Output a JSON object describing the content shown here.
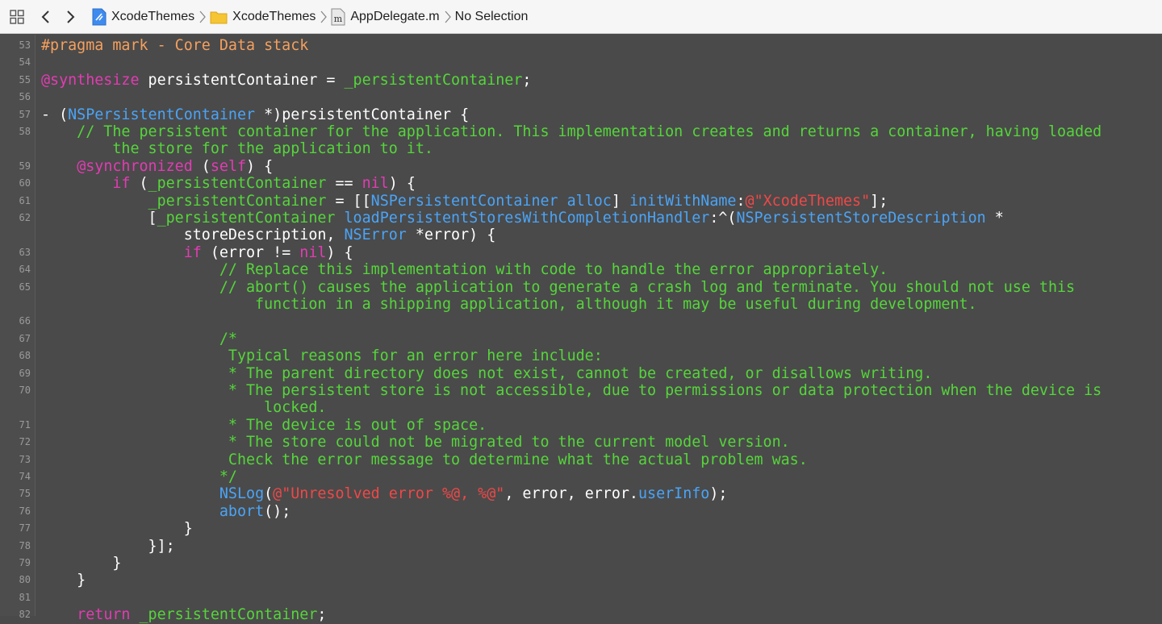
{
  "jumpbar": {
    "crumbs": [
      {
        "label": "XcodeThemes",
        "icon": "xcode-project-icon"
      },
      {
        "label": "XcodeThemes",
        "icon": "folder-icon"
      },
      {
        "label": "AppDelegate.m",
        "icon": "objc-file-icon",
        "icon_glyph": "m"
      },
      {
        "label": "No Selection",
        "icon": ""
      }
    ]
  },
  "colors": {
    "background": "#4a4a4a",
    "plain": "#ffffff",
    "keyword": "#e23cb3",
    "type": "#4aa4f7",
    "comment": "#55d63a",
    "string": "#f04848",
    "pragma": "#f5a05e"
  },
  "editor": {
    "lines": [
      {
        "n": "53",
        "segs": [
          [
            "pragma",
            "#pragma mark - Core Data stack"
          ]
        ]
      },
      {
        "n": "54",
        "segs": []
      },
      {
        "n": "55",
        "segs": [
          [
            "keyword",
            "@synthesize"
          ],
          [
            "plain",
            " persistentContainer = "
          ],
          [
            "comment",
            "_persistentContainer"
          ],
          [
            "plain",
            ";"
          ]
        ]
      },
      {
        "n": "56",
        "segs": []
      },
      {
        "n": "57",
        "segs": [
          [
            "plain",
            "- ("
          ],
          [
            "type",
            "NSPersistentContainer"
          ],
          [
            "plain",
            " *)persistentContainer {"
          ]
        ]
      },
      {
        "n": "58",
        "segs": [
          [
            "comment",
            "    // The persistent container for the application. This implementation creates and returns a container, having loaded"
          ]
        ]
      },
      {
        "n": "",
        "segs": [
          [
            "comment",
            "        the store for the application to it."
          ]
        ]
      },
      {
        "n": "59",
        "segs": [
          [
            "plain",
            "    "
          ],
          [
            "keyword",
            "@synchronized"
          ],
          [
            "plain",
            " ("
          ],
          [
            "keyword",
            "self"
          ],
          [
            "plain",
            ") {"
          ]
        ]
      },
      {
        "n": "60",
        "segs": [
          [
            "plain",
            "        "
          ],
          [
            "keyword",
            "if"
          ],
          [
            "plain",
            " ("
          ],
          [
            "comment",
            "_persistentContainer"
          ],
          [
            "plain",
            " == "
          ],
          [
            "keyword",
            "nil"
          ],
          [
            "plain",
            ") {"
          ]
        ]
      },
      {
        "n": "61",
        "segs": [
          [
            "plain",
            "            "
          ],
          [
            "comment",
            "_persistentContainer"
          ],
          [
            "plain",
            " = [["
          ],
          [
            "type",
            "NSPersistentContainer"
          ],
          [
            "plain",
            " "
          ],
          [
            "type",
            "alloc"
          ],
          [
            "plain",
            "] "
          ],
          [
            "type",
            "initWithName"
          ],
          [
            "plain",
            ":"
          ],
          [
            "string",
            "@\"XcodeThemes\""
          ],
          [
            "plain",
            "];"
          ]
        ]
      },
      {
        "n": "62",
        "segs": [
          [
            "plain",
            "            ["
          ],
          [
            "comment",
            "_persistentContainer"
          ],
          [
            "plain",
            " "
          ],
          [
            "type",
            "loadPersistentStoresWithCompletionHandler"
          ],
          [
            "plain",
            ":^("
          ],
          [
            "type",
            "NSPersistentStoreDescription"
          ],
          [
            "plain",
            " *"
          ]
        ]
      },
      {
        "n": "",
        "segs": [
          [
            "plain",
            "                storeDescription, "
          ],
          [
            "type",
            "NSError"
          ],
          [
            "plain",
            " *error) {"
          ]
        ]
      },
      {
        "n": "63",
        "segs": [
          [
            "plain",
            "                "
          ],
          [
            "keyword",
            "if"
          ],
          [
            "plain",
            " (error != "
          ],
          [
            "keyword",
            "nil"
          ],
          [
            "plain",
            ") {"
          ]
        ]
      },
      {
        "n": "64",
        "segs": [
          [
            "comment",
            "                    // Replace this implementation with code to handle the error appropriately."
          ]
        ]
      },
      {
        "n": "65",
        "segs": [
          [
            "comment",
            "                    // abort() causes the application to generate a crash log and terminate. You should not use this"
          ]
        ]
      },
      {
        "n": "",
        "segs": [
          [
            "comment",
            "                        function in a shipping application, although it may be useful during development."
          ]
        ]
      },
      {
        "n": "66",
        "segs": []
      },
      {
        "n": "67",
        "segs": [
          [
            "comment",
            "                    /*"
          ]
        ]
      },
      {
        "n": "68",
        "segs": [
          [
            "comment",
            "                     Typical reasons for an error here include:"
          ]
        ]
      },
      {
        "n": "69",
        "segs": [
          [
            "comment",
            "                     * The parent directory does not exist, cannot be created, or disallows writing."
          ]
        ]
      },
      {
        "n": "70",
        "segs": [
          [
            "comment",
            "                     * The persistent store is not accessible, due to permissions or data protection when the device is"
          ]
        ]
      },
      {
        "n": "",
        "segs": [
          [
            "comment",
            "                         locked."
          ]
        ]
      },
      {
        "n": "71",
        "segs": [
          [
            "comment",
            "                     * The device is out of space."
          ]
        ]
      },
      {
        "n": "72",
        "segs": [
          [
            "comment",
            "                     * The store could not be migrated to the current model version."
          ]
        ]
      },
      {
        "n": "73",
        "segs": [
          [
            "comment",
            "                     Check the error message to determine what the actual problem was."
          ]
        ]
      },
      {
        "n": "74",
        "segs": [
          [
            "comment",
            "                    */"
          ]
        ]
      },
      {
        "n": "75",
        "segs": [
          [
            "plain",
            "                    "
          ],
          [
            "type",
            "NSLog"
          ],
          [
            "plain",
            "("
          ],
          [
            "string",
            "@\"Unresolved error %@, %@\""
          ],
          [
            "plain",
            ", error, error."
          ],
          [
            "type",
            "userInfo"
          ],
          [
            "plain",
            ");"
          ]
        ]
      },
      {
        "n": "76",
        "segs": [
          [
            "plain",
            "                    "
          ],
          [
            "type",
            "abort"
          ],
          [
            "plain",
            "();"
          ]
        ]
      },
      {
        "n": "77",
        "segs": [
          [
            "plain",
            "                }"
          ]
        ]
      },
      {
        "n": "78",
        "segs": [
          [
            "plain",
            "            }];"
          ]
        ]
      },
      {
        "n": "79",
        "segs": [
          [
            "plain",
            "        }"
          ]
        ]
      },
      {
        "n": "80",
        "segs": [
          [
            "plain",
            "    }"
          ]
        ]
      },
      {
        "n": "81",
        "segs": []
      },
      {
        "n": "82",
        "segs": [
          [
            "plain",
            "    "
          ],
          [
            "keyword",
            "return"
          ],
          [
            "plain",
            " "
          ],
          [
            "comment",
            "_persistentContainer"
          ],
          [
            "plain",
            ";"
          ]
        ]
      }
    ]
  }
}
